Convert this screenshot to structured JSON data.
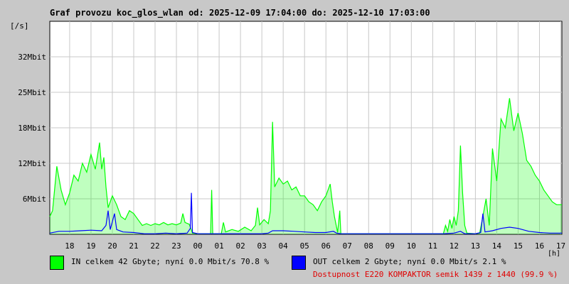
{
  "chart_data": {
    "type": "line",
    "title": "Graf provozu koc_glos_wlan od: 2025-12-09 17:04:00 do: 2025-12-10 17:03:00",
    "ylabel": "[/s]",
    "xlabel": "[h]",
    "x_tick_labels": [
      "18",
      "19",
      "20",
      "21",
      "22",
      "23",
      "00",
      "01",
      "02",
      "03",
      "04",
      "05",
      "06",
      "07",
      "08",
      "09",
      "10",
      "11",
      "12",
      "13",
      "14",
      "15",
      "16",
      "17"
    ],
    "x_range_hours": [
      17.07,
      41.05
    ],
    "y_tick_labels": [
      "6Mbit",
      "12Mbit",
      "18Mbit",
      "25Mbit",
      "32Mbit"
    ],
    "y_tick_values": [
      6,
      12,
      18,
      24,
      30
    ],
    "ylim": [
      0,
      36
    ],
    "grid": true,
    "series": [
      {
        "name": "IN",
        "color": "#00ff00",
        "stroke": "#22cc22",
        "points": [
          [
            17.07,
            3.0
          ],
          [
            17.2,
            4.0
          ],
          [
            17.4,
            11.5
          ],
          [
            17.6,
            7.5
          ],
          [
            17.8,
            5.0
          ],
          [
            18.0,
            7.0
          ],
          [
            18.2,
            10.0
          ],
          [
            18.4,
            9.0
          ],
          [
            18.6,
            12.0
          ],
          [
            18.8,
            10.5
          ],
          [
            19.0,
            13.5
          ],
          [
            19.2,
            11.0
          ],
          [
            19.4,
            15.5
          ],
          [
            19.5,
            11.0
          ],
          [
            19.6,
            13.0
          ],
          [
            19.7,
            8.0
          ],
          [
            19.8,
            4.5
          ],
          [
            20.0,
            6.5
          ],
          [
            20.2,
            5.0
          ],
          [
            20.4,
            3.0
          ],
          [
            20.6,
            2.5
          ],
          [
            20.8,
            4.0
          ],
          [
            21.0,
            3.5
          ],
          [
            21.2,
            2.5
          ],
          [
            21.4,
            1.5
          ],
          [
            21.6,
            1.8
          ],
          [
            21.8,
            1.5
          ],
          [
            22.0,
            1.8
          ],
          [
            22.2,
            1.6
          ],
          [
            22.4,
            2.0
          ],
          [
            22.6,
            1.6
          ],
          [
            22.8,
            1.8
          ],
          [
            23.0,
            1.6
          ],
          [
            23.2,
            1.9
          ],
          [
            23.3,
            3.5
          ],
          [
            23.4,
            2.0
          ],
          [
            23.6,
            1.7
          ],
          [
            23.75,
            0.2
          ],
          [
            24.0,
            0.1
          ],
          [
            24.6,
            0.1
          ],
          [
            24.65,
            7.5
          ],
          [
            24.7,
            0.1
          ],
          [
            25.1,
            0.1
          ],
          [
            25.2,
            2.0
          ],
          [
            25.3,
            0.4
          ],
          [
            25.6,
            0.8
          ],
          [
            25.9,
            0.5
          ],
          [
            26.2,
            1.2
          ],
          [
            26.5,
            0.6
          ],
          [
            26.7,
            1.5
          ],
          [
            26.8,
            4.5
          ],
          [
            26.9,
            1.6
          ],
          [
            27.1,
            2.5
          ],
          [
            27.3,
            1.8
          ],
          [
            27.4,
            4.0
          ],
          [
            27.5,
            19.0
          ],
          [
            27.6,
            8.0
          ],
          [
            27.8,
            9.5
          ],
          [
            28.0,
            8.5
          ],
          [
            28.2,
            9.0
          ],
          [
            28.4,
            7.5
          ],
          [
            28.6,
            8.0
          ],
          [
            28.8,
            6.5
          ],
          [
            29.0,
            6.5
          ],
          [
            29.2,
            5.5
          ],
          [
            29.4,
            5.0
          ],
          [
            29.6,
            4.0
          ],
          [
            29.8,
            5.5
          ],
          [
            30.0,
            6.5
          ],
          [
            30.2,
            8.5
          ],
          [
            30.3,
            5.5
          ],
          [
            30.4,
            3.0
          ],
          [
            30.55,
            0.3
          ],
          [
            30.65,
            4.0
          ],
          [
            30.7,
            0.1
          ],
          [
            31.0,
            0.1
          ],
          [
            35.5,
            0.1
          ],
          [
            35.6,
            1.5
          ],
          [
            35.7,
            0.5
          ],
          [
            35.8,
            2.5
          ],
          [
            35.9,
            1.0
          ],
          [
            36.0,
            3.0
          ],
          [
            36.1,
            1.5
          ],
          [
            36.2,
            4.0
          ],
          [
            36.3,
            15.0
          ],
          [
            36.4,
            7.0
          ],
          [
            36.5,
            1.5
          ],
          [
            36.6,
            0.2
          ],
          [
            37.0,
            0.1
          ],
          [
            37.2,
            0.2
          ],
          [
            37.35,
            3.0
          ],
          [
            37.5,
            6.0
          ],
          [
            37.65,
            1.5
          ],
          [
            37.8,
            14.5
          ],
          [
            38.0,
            9.0
          ],
          [
            38.2,
            19.5
          ],
          [
            38.4,
            18.0
          ],
          [
            38.6,
            23.0
          ],
          [
            38.8,
            17.5
          ],
          [
            39.0,
            20.5
          ],
          [
            39.2,
            17.0
          ],
          [
            39.4,
            12.5
          ],
          [
            39.6,
            11.5
          ],
          [
            39.8,
            10.0
          ],
          [
            40.0,
            9.0
          ],
          [
            40.2,
            7.5
          ],
          [
            40.4,
            6.5
          ],
          [
            40.6,
            5.5
          ],
          [
            40.8,
            5.0
          ],
          [
            41.05,
            5.0
          ]
        ],
        "legend": "IN celkem 42 Gbyte; nyní   0.0 Mbit/s 70.8 %"
      },
      {
        "name": "OUT",
        "color": "#0000ff",
        "stroke": "#0000cc",
        "points": [
          [
            17.07,
            0.2
          ],
          [
            17.5,
            0.5
          ],
          [
            18.0,
            0.5
          ],
          [
            18.5,
            0.6
          ],
          [
            19.0,
            0.7
          ],
          [
            19.5,
            0.6
          ],
          [
            19.7,
            1.5
          ],
          [
            19.8,
            4.0
          ],
          [
            19.9,
            0.8
          ],
          [
            20.1,
            3.5
          ],
          [
            20.2,
            0.8
          ],
          [
            20.5,
            0.4
          ],
          [
            21.0,
            0.3
          ],
          [
            21.5,
            0.1
          ],
          [
            22.0,
            0.1
          ],
          [
            22.5,
            0.2
          ],
          [
            23.0,
            0.1
          ],
          [
            23.5,
            0.2
          ],
          [
            23.65,
            1.0
          ],
          [
            23.7,
            7.0
          ],
          [
            23.75,
            0.3
          ],
          [
            24.0,
            0.1
          ],
          [
            27.0,
            0.1
          ],
          [
            27.3,
            0.2
          ],
          [
            27.5,
            0.6
          ],
          [
            28.0,
            0.6
          ],
          [
            28.5,
            0.5
          ],
          [
            29.0,
            0.4
          ],
          [
            29.5,
            0.3
          ],
          [
            30.0,
            0.3
          ],
          [
            30.35,
            0.5
          ],
          [
            30.5,
            0.2
          ],
          [
            30.7,
            0.1
          ],
          [
            31.0,
            0.1
          ],
          [
            35.5,
            0.1
          ],
          [
            36.0,
            0.2
          ],
          [
            36.3,
            0.5
          ],
          [
            36.5,
            0.1
          ],
          [
            37.0,
            0.1
          ],
          [
            37.25,
            0.3
          ],
          [
            37.35,
            3.5
          ],
          [
            37.45,
            0.4
          ],
          [
            37.8,
            0.6
          ],
          [
            38.2,
            1.0
          ],
          [
            38.6,
            1.2
          ],
          [
            39.0,
            1.0
          ],
          [
            39.5,
            0.5
          ],
          [
            40.0,
            0.3
          ],
          [
            40.5,
            0.2
          ],
          [
            41.05,
            0.2
          ]
        ],
        "legend": "OUT celkem 2 Gbyte; nyní   0.0 Mbit/s 2.1 %"
      }
    ],
    "availability": "Dostupnost E220 KOMPAKTOR semik 1439 z 1440 (99.9 %)"
  }
}
